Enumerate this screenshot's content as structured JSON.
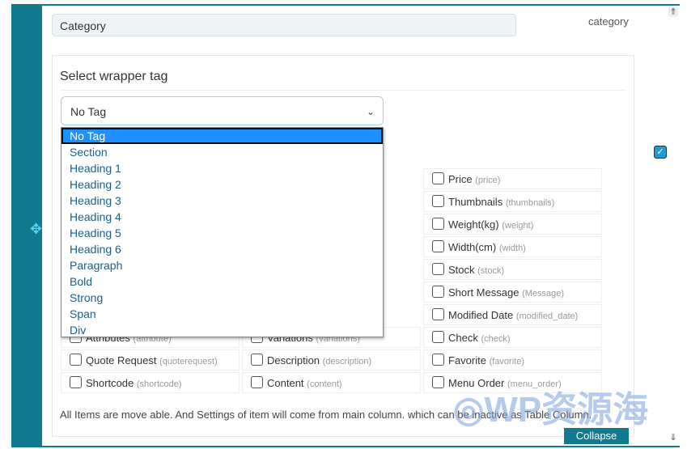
{
  "field": {
    "label_value": "Category",
    "key": "category"
  },
  "wrapper": {
    "heading": "Select wrapper tag",
    "selected": "No Tag",
    "options": [
      "No Tag",
      "Section",
      "Heading 1",
      "Heading 2",
      "Heading 3",
      "Heading 4",
      "Heading 5",
      "Heading 6",
      "Paragraph",
      "Bold",
      "Strong",
      "Span",
      "Div"
    ]
  },
  "items": [
    {
      "row": 0,
      "col": 2,
      "label": "Price",
      "key": "(price)"
    },
    {
      "row": 1,
      "col": 2,
      "label": "Thumbnails",
      "key": "(thumbnails)"
    },
    {
      "row": 2,
      "col": 2,
      "label": "Weight(kg)",
      "key": "(weight)"
    },
    {
      "row": 3,
      "col": 2,
      "label": "Width(cm)",
      "key": "(width)"
    },
    {
      "row": 4,
      "col": 2,
      "label": "Stock",
      "key": "(stock)"
    },
    {
      "row": 5,
      "col": 2,
      "label": "Short Message",
      "key": "(Message)"
    },
    {
      "row": 6,
      "col": 2,
      "label": "Modified Date",
      "key": "(modified_date)"
    },
    {
      "row": 7,
      "col": 0,
      "label": "Attributes",
      "key": "(attribute)"
    },
    {
      "row": 7,
      "col": 1,
      "label": "Variations",
      "key": "(variations)"
    },
    {
      "row": 7,
      "col": 2,
      "label": "Check",
      "key": "(check)"
    },
    {
      "row": 8,
      "col": 0,
      "label": "Quote Request",
      "key": "(quoterequest)"
    },
    {
      "row": 8,
      "col": 1,
      "label": "Description",
      "key": "(description)"
    },
    {
      "row": 8,
      "col": 2,
      "label": "Favorite",
      "key": "(favorite)"
    },
    {
      "row": 9,
      "col": 0,
      "label": "Shortcode",
      "key": "(shortcode)"
    },
    {
      "row": 9,
      "col": 1,
      "label": "Content",
      "key": "(content)"
    },
    {
      "row": 9,
      "col": 2,
      "label": "Menu Order",
      "key": "(menu_order)"
    }
  ],
  "note": "All Items are move able. And Settings of item will come from main column. which can be inactive as Table Column.",
  "collapse_label": "Collapse",
  "watermark": "WP资源海",
  "colors": {
    "accent": "#127a90",
    "selected": "#1e90ff"
  }
}
